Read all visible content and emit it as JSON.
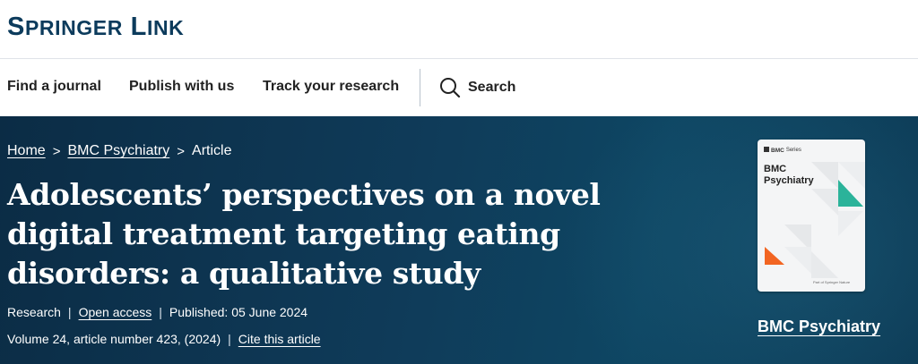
{
  "header": {
    "logo_first": "S",
    "logo_rest": "PRINGER",
    "logo_first2": "L",
    "logo_rest2": "INK"
  },
  "nav": {
    "items": [
      {
        "label": "Find a journal"
      },
      {
        "label": "Publish with us"
      },
      {
        "label": "Track your research"
      }
    ],
    "search_label": "Search"
  },
  "breadcrumb": {
    "home": "Home",
    "journal": "BMC Psychiatry",
    "current": "Article",
    "separator": ">"
  },
  "article": {
    "title": "Adolescents’ perspectives on a novel digital treatment targeting eating disorders: a qualitative study",
    "type": "Research",
    "access": "Open access",
    "published": "Published: 05 June 2024",
    "volume": "Volume 24, article number 423, (2024)",
    "cite": "Cite this article"
  },
  "journal": {
    "cover_series_brand": "BMC",
    "cover_series_label": "Series",
    "cover_title_line1": "BMC",
    "cover_title_line2": "Psychiatry",
    "cover_footer": "Part of Springer Nature",
    "name": "BMC Psychiatry"
  },
  "colors": {
    "brand": "#0c3b5c",
    "hero_bg": "#0f3b59",
    "cover_accent_green": "#2bb39a",
    "cover_accent_orange": "#f26522"
  }
}
